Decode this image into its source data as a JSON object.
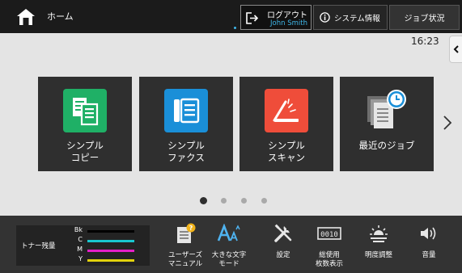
{
  "topbar": {
    "home_label": "ホーム",
    "logout_label": "ログアウト",
    "logout_user": "John Smith",
    "sysinfo_label": "システム情報",
    "jobstatus_label": "ジョブ状況"
  },
  "clock": "16:23",
  "tiles": [
    {
      "line1": "シンプル",
      "line2": "コピー",
      "icon": "copy-icon",
      "color": "#1fb066"
    },
    {
      "line1": "シンプル",
      "line2": "ファクス",
      "icon": "fax-icon",
      "color": "#1a8fd8"
    },
    {
      "line1": "シンプル",
      "line2": "スキャン",
      "icon": "scan-icon",
      "color": "#ef4d3a"
    },
    {
      "line1": "最近のジョブ",
      "line2": "",
      "icon": "recent-jobs-icon",
      "color": "#2f2f2f"
    }
  ],
  "pager": {
    "count": 4,
    "active": 0
  },
  "toner": {
    "title": "トナー残量",
    "rows": [
      {
        "label": "Bk",
        "color": "#000000",
        "level": 1.0
      },
      {
        "label": "C",
        "color": "#19c6cf",
        "level": 1.0
      },
      {
        "label": "M",
        "color": "#e51fc8",
        "level": 1.0
      },
      {
        "label": "Y",
        "color": "#e2d20c",
        "level": 1.0
      }
    ]
  },
  "tools": [
    {
      "label": "ユーザーズ\nマニュアル",
      "icon": "user-manual-icon"
    },
    {
      "label": "大きな文字\nモード",
      "icon": "large-text-icon"
    },
    {
      "label": "設定",
      "icon": "settings-icon"
    },
    {
      "label": "総使用\n枚数表示",
      "icon": "page-count-icon"
    },
    {
      "label": "明度調整",
      "icon": "brightness-icon"
    },
    {
      "label": "音量",
      "icon": "volume-icon"
    }
  ]
}
